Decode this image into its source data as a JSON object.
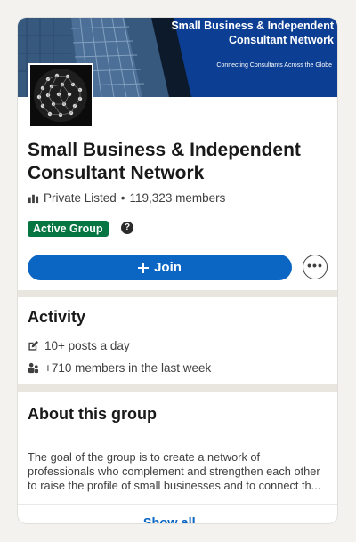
{
  "banner": {
    "title": "Small Business & Independent Consultant Network",
    "tagline": "Connecting Consultants Across the Globe"
  },
  "group": {
    "name": "Small Business & Independent Consultant Network",
    "visibility": "Private Listed",
    "separator": "•",
    "members": "119,323 members",
    "badge": "Active Group",
    "help_symbol": "?",
    "join_label": "Join",
    "more_symbol": "•••"
  },
  "activity": {
    "heading": "Activity",
    "items": [
      {
        "icon": "edit-icon",
        "text": "10+ posts a day"
      },
      {
        "icon": "members-icon",
        "text": "+710 members in the last week"
      }
    ]
  },
  "about": {
    "heading": "About this group",
    "lines": [
      "The goal of the group is to create a network of",
      "professionals who complement and strengthen each other",
      "to raise the profile of small businesses and to connect th..."
    ],
    "show_all": "Show all →"
  },
  "colors": {
    "primary": "#0a66c2",
    "badge_green": "#057642",
    "banner_navy": "#0c3e93",
    "section_gap": "#e9e6df"
  }
}
